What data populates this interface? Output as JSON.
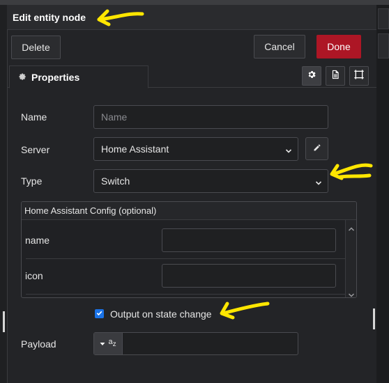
{
  "header": {
    "title": "Edit entity node"
  },
  "actions": {
    "delete_label": "Delete",
    "cancel_label": "Cancel",
    "done_label": "Done"
  },
  "tabs": {
    "properties_label": "Properties"
  },
  "form": {
    "name_label": "Name",
    "name_placeholder": "Name",
    "name_value": "",
    "server_label": "Server",
    "server_value": "Home Assistant",
    "type_label": "Type",
    "type_value": "Switch",
    "config_title": "Home Assistant Config (optional)",
    "config_rows": [
      {
        "label": "name",
        "value": ""
      },
      {
        "label": "icon",
        "value": ""
      }
    ],
    "output_label": "Output on state change",
    "output_checked": true,
    "payload_label": "Payload",
    "payload_type_glyph": "a",
    "payload_type_sub": "z",
    "payload_value": ""
  },
  "colors": {
    "accent_done": "#ad1625",
    "checkbox": "#1a73e8",
    "annotation": "#ffe600",
    "background": "#1f2022"
  },
  "icons": {
    "tab": "gear-icon",
    "tools": [
      "gear-icon",
      "document-icon",
      "frame-icon"
    ],
    "server_edit": "pencil-icon"
  }
}
